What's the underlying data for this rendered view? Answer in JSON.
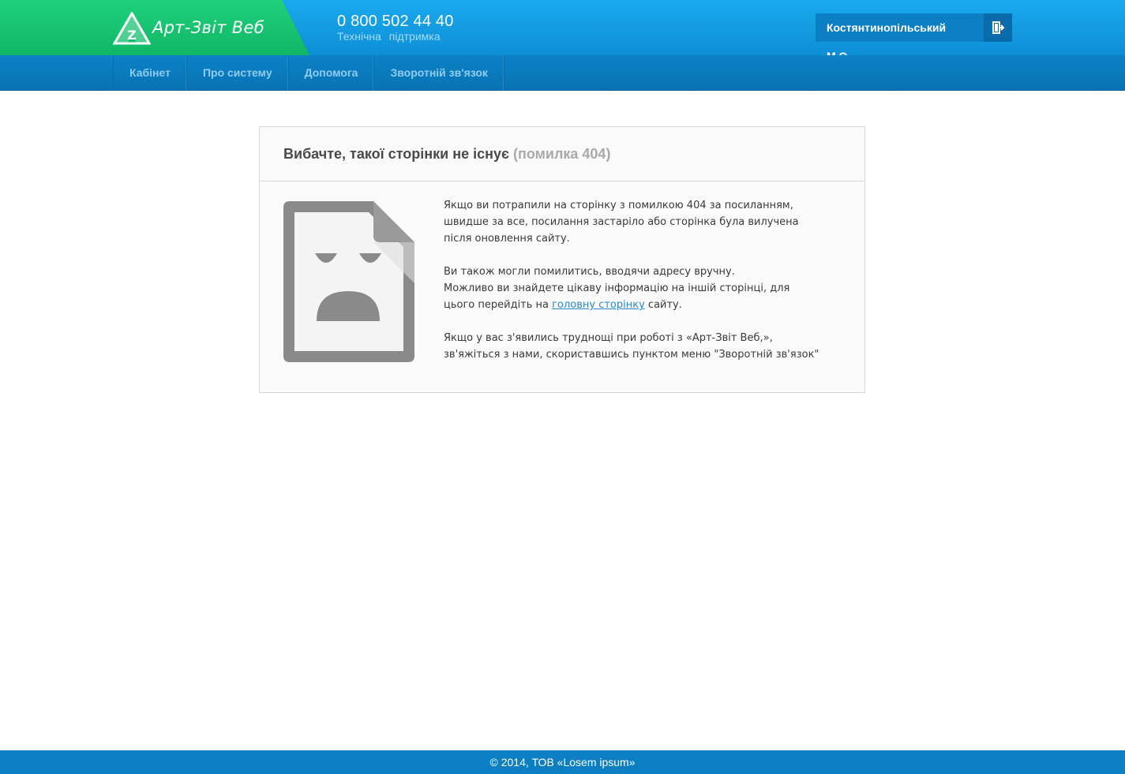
{
  "header": {
    "brand": "Арт-Звіт Веб",
    "phone": "0 800 502 44 40",
    "support": "Технічна підтримка",
    "user_name": "Костянтинопільський М.О.",
    "logout_icon": "logout-icon"
  },
  "nav": {
    "items": [
      {
        "label": "Кабінет"
      },
      {
        "label": "Про систему"
      },
      {
        "label": "Допомога"
      },
      {
        "label": "Зворотній зв'язок"
      }
    ]
  },
  "error": {
    "title": "Вибачте, такої сторінки не існує",
    "code": "(помилка 404)",
    "p1": "Якщо ви потрапили на сторінку з помилкою 404 за посиланням, швидше за все, посилання застаріло або сторінка була вилучена після оновлення сайту.",
    "p2_line1": "Ви також могли помилитись, вводячи адресу вручну.",
    "p2_line2_pre": "Можливо ви знайдете цікаву інформацію на іншій сторінці, для цього перейдіть на",
    "p2_link": "головну сторінку",
    "p2_post": "сайту.",
    "p3": "Якщо у вас з'явились труднощі при роботі з «Арт-Звіт Веб,», зв'яжіться з нами, скориставшись пунктом меню \"Зворотній зв'язок\"",
    "illustration_icon": "sad-document-icon"
  },
  "footer": {
    "copyright": "© 2014, ТОВ «Losem ipsum»"
  },
  "colors": {
    "header_blue": "#1aa9ef",
    "brand_green": "#1fd07c",
    "nav_blue": "#0c82c7",
    "link_blue": "#2a87c8",
    "footer_blue": "#0c7fc2"
  }
}
